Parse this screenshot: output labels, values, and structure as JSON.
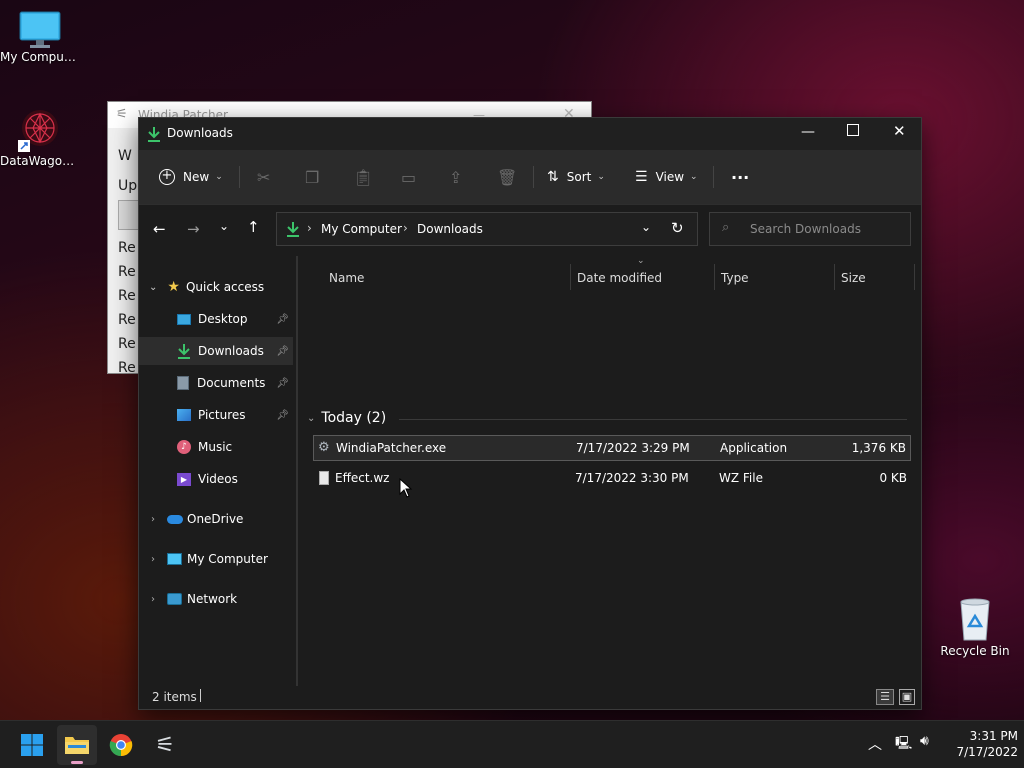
{
  "desktop": {
    "icons": [
      {
        "label": "My Computer"
      },
      {
        "label": "DataWagon..."
      },
      {
        "label": "Recycle Bin"
      }
    ]
  },
  "patcher_window": {
    "title": "Windia Patcher",
    "lines": [
      "W",
      "Up",
      "Re",
      "Re",
      "Re",
      "Re",
      "Re",
      "Re"
    ]
  },
  "explorer": {
    "title": "Downloads",
    "toolbar": {
      "new_label": "New",
      "sort_label": "Sort",
      "view_label": "View",
      "more_label": "···"
    },
    "address": {
      "segments": [
        "My Computer",
        "Downloads"
      ],
      "separator": "›"
    },
    "search": {
      "placeholder": "Search Downloads"
    },
    "nav": {
      "quick_access": "Quick access",
      "items": [
        {
          "label": "Desktop",
          "pinned": true
        },
        {
          "label": "Downloads",
          "pinned": true,
          "selected": true
        },
        {
          "label": "Documents",
          "pinned": true
        },
        {
          "label": "Pictures",
          "pinned": true
        },
        {
          "label": "Music",
          "pinned": false
        },
        {
          "label": "Videos",
          "pinned": false
        }
      ],
      "roots": [
        {
          "label": "OneDrive"
        },
        {
          "label": "My Computer"
        },
        {
          "label": "Network"
        }
      ]
    },
    "columns": {
      "name": "Name",
      "date": "Date modified",
      "type": "Type",
      "size": "Size"
    },
    "group_label": "Today (2)",
    "files": [
      {
        "name": "WindiaPatcher.exe",
        "date": "7/17/2022 3:29 PM",
        "type": "Application",
        "size": "1,376 KB",
        "selected": true
      },
      {
        "name": "Effect.wz",
        "date": "7/17/2022 3:30 PM",
        "type": "WZ File",
        "size": "0 KB",
        "selected": false
      }
    ],
    "status": {
      "count": "2 items"
    }
  },
  "taskbar": {
    "time": "3:31 PM",
    "date": "7/17/2022"
  },
  "colors": {
    "accent_download": "#3cc46a",
    "folder_yellow": "#f2c94c",
    "windows_blue": "#2aa0ef"
  }
}
